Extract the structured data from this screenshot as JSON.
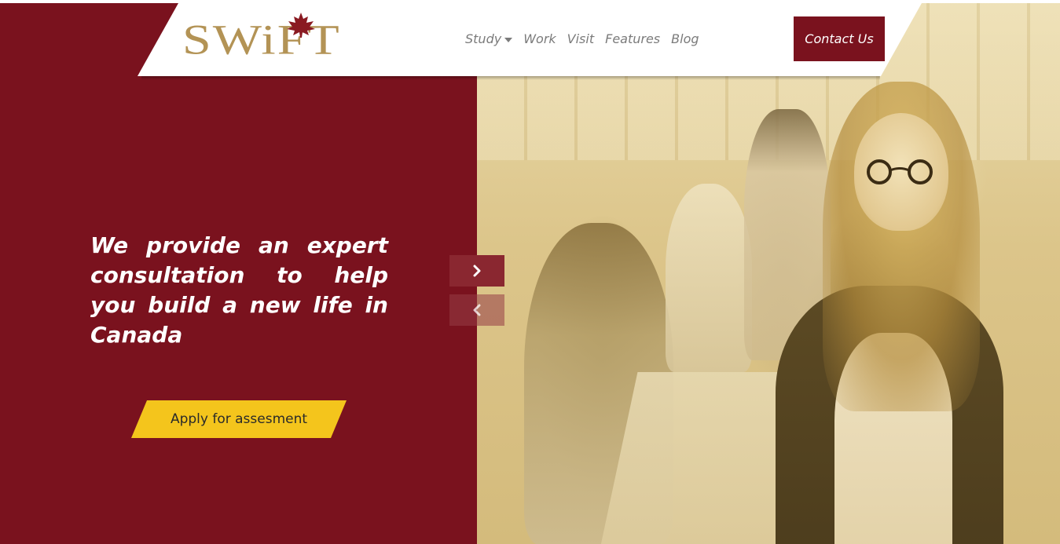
{
  "brand": {
    "logo_text": "SWiFT",
    "logo_icon": "maple-leaf-icon",
    "color": "#b39355"
  },
  "nav": {
    "items": [
      {
        "label": "Study",
        "has_dropdown": true
      },
      {
        "label": "Work"
      },
      {
        "label": "Visit"
      },
      {
        "label": "Features"
      },
      {
        "label": "Blog"
      }
    ],
    "contact_label": "Contact Us"
  },
  "hero": {
    "headline": "We provide an expert consultation to help you build a new life in Canada",
    "cta_label": "Apply for assesment"
  },
  "carousel": {
    "next_icon": "chevron-right-icon",
    "prev_icon": "chevron-left-icon"
  },
  "colors": {
    "primary": "#7a121e",
    "accent": "#f4c51c",
    "photo_tint": "#d9c48a"
  }
}
